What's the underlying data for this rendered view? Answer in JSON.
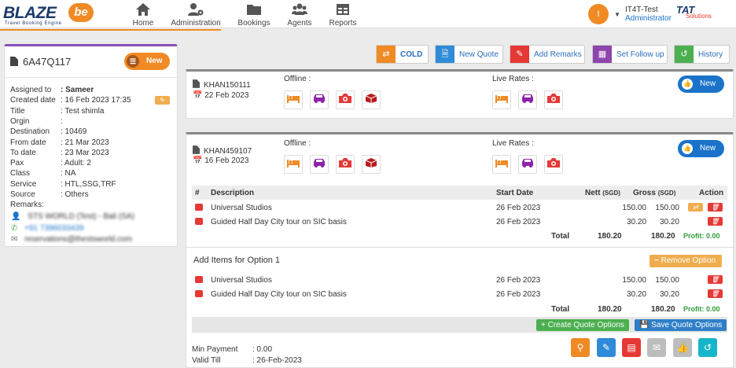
{
  "brand": {
    "logo_word": "BLAZE",
    "logo_badge": "be",
    "tagline": "Travel Booking Engine",
    "partner_name": "TAT",
    "partner_sub": "Solutions"
  },
  "nav": [
    {
      "label": "Home",
      "icon": "home-icon"
    },
    {
      "label": "Administration",
      "icon": "users-cog-icon"
    },
    {
      "label": "Bookings",
      "icon": "folder-icon"
    },
    {
      "label": "Agents",
      "icon": "agents-icon"
    },
    {
      "label": "Reports",
      "icon": "table-icon"
    }
  ],
  "user": {
    "initial": "I",
    "name": "IT4T-Test",
    "role": "Administrator"
  },
  "quote": {
    "id": "6A47Q117",
    "status": "New",
    "fields": [
      {
        "k": "Assigned to",
        "v": ": Sameer"
      },
      {
        "k": "Created date",
        "v": ": 16 Feb 2023 17:35"
      },
      {
        "k": "Title",
        "v": ": Test shimla"
      },
      {
        "k": "Orgin",
        "v": ":"
      },
      {
        "k": "Destination",
        "v": ": 10469"
      },
      {
        "k": "From date",
        "v": ": 21 Mar 2023"
      },
      {
        "k": "To date",
        "v": ": 23 Mar 2023"
      },
      {
        "k": "Pax",
        "v": ": Adult: 2"
      },
      {
        "k": "Class",
        "v": ": NA"
      },
      {
        "k": "Service",
        "v": ": HTL,SSG,TRF"
      },
      {
        "k": "Source",
        "v": ": Others"
      }
    ],
    "remarks_label": "Remarks:",
    "contacts": [
      "STS WORLD (Test) - Bali (SA)",
      "+91 7396033439",
      "reservations@thestsworld.com"
    ]
  },
  "toolbar": {
    "cold": "COLD",
    "new_quote": "New Quote",
    "add_remarks": "Add Remarks",
    "set_follow_up": "Set Follow up",
    "history": "History"
  },
  "option1": {
    "code": "KHAN150111",
    "date": "22 Feb 2023",
    "offline_label": "Offline :",
    "live_label": "Live Rates :",
    "status": "New"
  },
  "option2": {
    "code": "KHAN459107",
    "date": "16 Feb 2023",
    "offline_label": "Offline :",
    "live_label": "Live Rates :",
    "status": "New",
    "headers": {
      "num": "#",
      "desc": "Description",
      "start": "Start Date",
      "nett": "Nett",
      "nett_cur": "(SGD)",
      "gross": "Gross",
      "gross_cur": "(SGD)",
      "action": "Action"
    },
    "items": [
      {
        "desc": "Universal Studios",
        "start": "26 Feb 2023",
        "nett": "150.00",
        "gross": "150.00"
      },
      {
        "desc": "Guided Half Day City tour on SIC basis",
        "start": "26 Feb 2023",
        "nett": "30.20",
        "gross": "30.20"
      }
    ],
    "total_label": "Total",
    "total_nett": "180.20",
    "total_gross": "180.20",
    "profit": "Profit: 0.00",
    "add_items_label": "Add Items for Option 1",
    "remove_option": "Remove Option",
    "add_items": [
      {
        "desc": "Universal Studios",
        "start": "26 Feb 2023",
        "nett": "150.00",
        "gross": "150.00"
      },
      {
        "desc": "Guided Half Day City tour on SIC basis",
        "start": "26 Feb 2023",
        "nett": "30.20",
        "gross": "30.20"
      }
    ],
    "total2_nett": "180.20",
    "total2_gross": "180.20",
    "profit2": "Profit: 0.00",
    "create_options": "Create Quote Options",
    "save_options": "Save Quote Options",
    "min_payment_label": "Min Payment",
    "min_payment": ": 0.00",
    "valid_till_label": "Valid Till",
    "valid_till": ": 26-Feb-2023"
  },
  "colors": {
    "orange": "#f08a24",
    "blue": "#1a73c9",
    "red": "#e53935",
    "purple": "#8e44ad",
    "green": "#4caf50",
    "teal": "#17b5c9"
  }
}
